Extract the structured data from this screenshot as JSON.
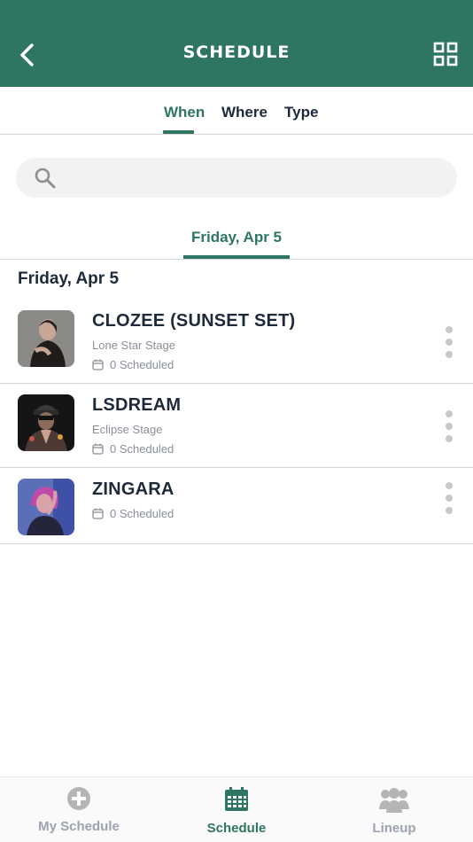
{
  "header": {
    "title": "SCHEDULE",
    "back_icon": "chevron-left-icon",
    "grid_icon": "grid-icon"
  },
  "filter_tabs": [
    {
      "label": "When",
      "active": true
    },
    {
      "label": "Where",
      "active": false
    },
    {
      "label": "Type",
      "active": false
    }
  ],
  "search": {
    "placeholder": "",
    "value": ""
  },
  "date_tabs": [
    {
      "label": "Friday, Apr 5",
      "active": true
    }
  ],
  "section": {
    "heading": "Friday, Apr 5"
  },
  "artists": [
    {
      "name": "CLOZEE (SUNSET SET)",
      "stage": "Lone Star Stage",
      "scheduled": "0 Scheduled"
    },
    {
      "name": "LSDREAM",
      "stage": "Eclipse Stage",
      "scheduled": "0 Scheduled"
    },
    {
      "name": "ZINGARA",
      "stage": "",
      "scheduled": "0 Scheduled"
    }
  ],
  "bottom_nav": [
    {
      "label": "My Schedule",
      "icon": "plus-circle-icon",
      "active": false
    },
    {
      "label": "Schedule",
      "icon": "calendar-icon",
      "active": true
    },
    {
      "label": "Lineup",
      "icon": "users-icon",
      "active": false
    }
  ],
  "colors": {
    "brand": "#2e7563",
    "muted": "#8a8f98",
    "inactive_nav": "#9ca3af"
  }
}
